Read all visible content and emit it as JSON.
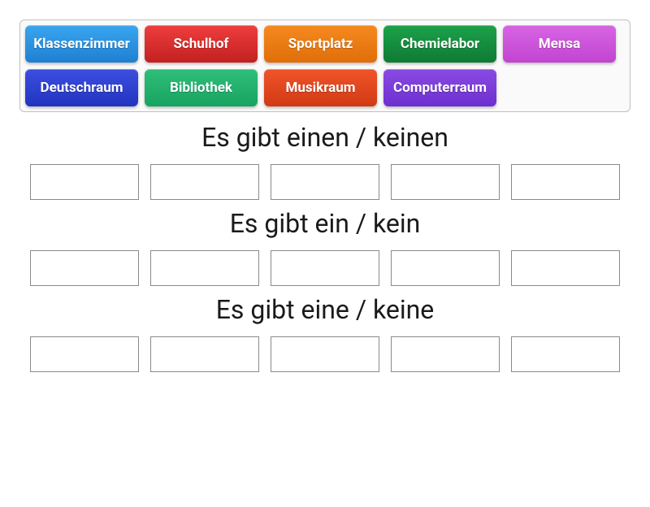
{
  "tray": {
    "row1": [
      {
        "label": "Klassenzimmer",
        "colorClass": "c-blue",
        "name": "card-klassenzimmer"
      },
      {
        "label": "Schulhof",
        "colorClass": "c-red",
        "name": "card-schulhof"
      },
      {
        "label": "Sportplatz",
        "colorClass": "c-orange",
        "name": "card-sportplatz"
      },
      {
        "label": "Chemielabor",
        "colorClass": "c-green",
        "name": "card-chemielabor"
      },
      {
        "label": "Mensa",
        "colorClass": "c-magenta",
        "name": "card-mensa"
      }
    ],
    "row2": [
      {
        "label": "Deutschraum",
        "colorClass": "c-darkblue",
        "name": "card-deutschraum"
      },
      {
        "label": "Bibliothek",
        "colorClass": "c-teal",
        "name": "card-bibliothek"
      },
      {
        "label": "Musikraum",
        "colorClass": "c-redorange",
        "name": "card-musikraum"
      },
      {
        "label": "Computerraum",
        "colorClass": "c-purple",
        "name": "card-computerraum"
      }
    ]
  },
  "groups": [
    {
      "title": "Es gibt einen / keinen",
      "slots": 5
    },
    {
      "title": "Es gibt ein / kein",
      "slots": 5
    },
    {
      "title": "Es gibt eine / keine",
      "slots": 5
    }
  ]
}
